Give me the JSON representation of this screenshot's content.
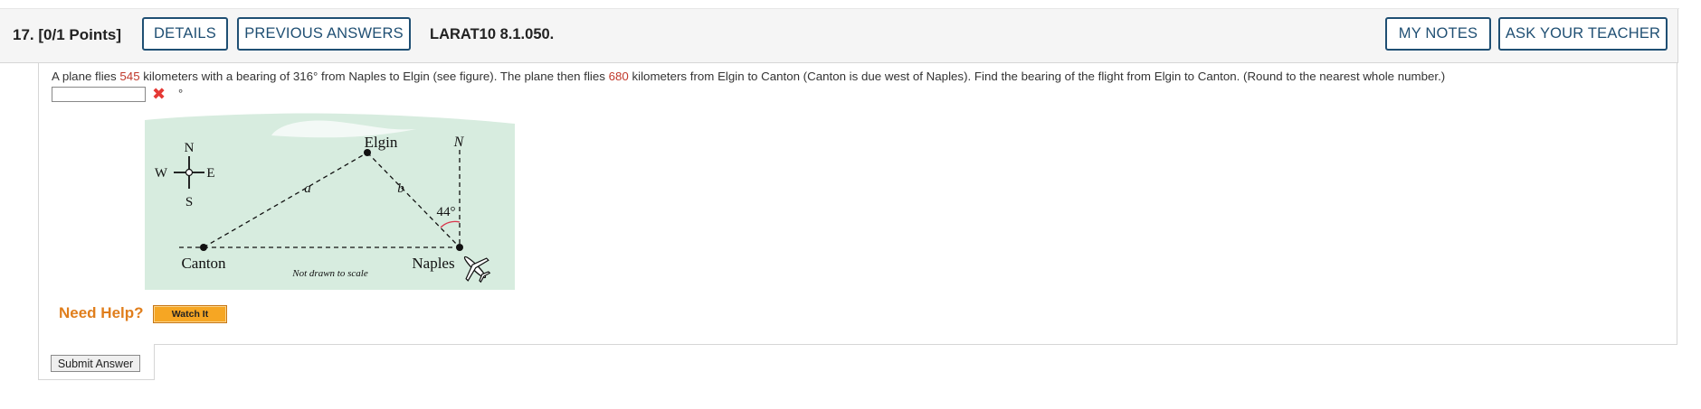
{
  "header": {
    "question_number": "17.",
    "points": "[0/1 Points]",
    "details_label": "DETAILS",
    "previous_answers_label": "PREVIOUS ANSWERS",
    "problem_code": "LARAT10 8.1.050.",
    "my_notes_label": "MY NOTES",
    "ask_teacher_label": "ASK YOUR TEACHER"
  },
  "question": {
    "part1": "A plane flies ",
    "distance1": "545",
    "part2": " kilometers with a bearing of 316° from Naples to Elgin (see figure). The plane then flies ",
    "distance2": "680",
    "part3": " kilometers from Elgin to Canton (Canton is due west of Naples). Find the bearing of the flight from Elgin to Canton. (Round to the nearest whole number.)",
    "answer_value": "",
    "answer_status_icon": "x-icon",
    "unit": "°"
  },
  "figure": {
    "compass_n": "N",
    "compass_e": "E",
    "compass_s": "S",
    "compass_w": "W",
    "elgin": "Elgin",
    "canton": "Canton",
    "naples": "Naples",
    "north": "N",
    "side_a": "a",
    "side_b": "b",
    "angle": "44°",
    "note": "Not drawn to scale",
    "background_color": "#d7ecdf",
    "angle_arc_color": "#d9344a"
  },
  "help": {
    "need_help": "Need Help?",
    "watch_it": "Watch It"
  },
  "submit_label": "Submit Answer"
}
